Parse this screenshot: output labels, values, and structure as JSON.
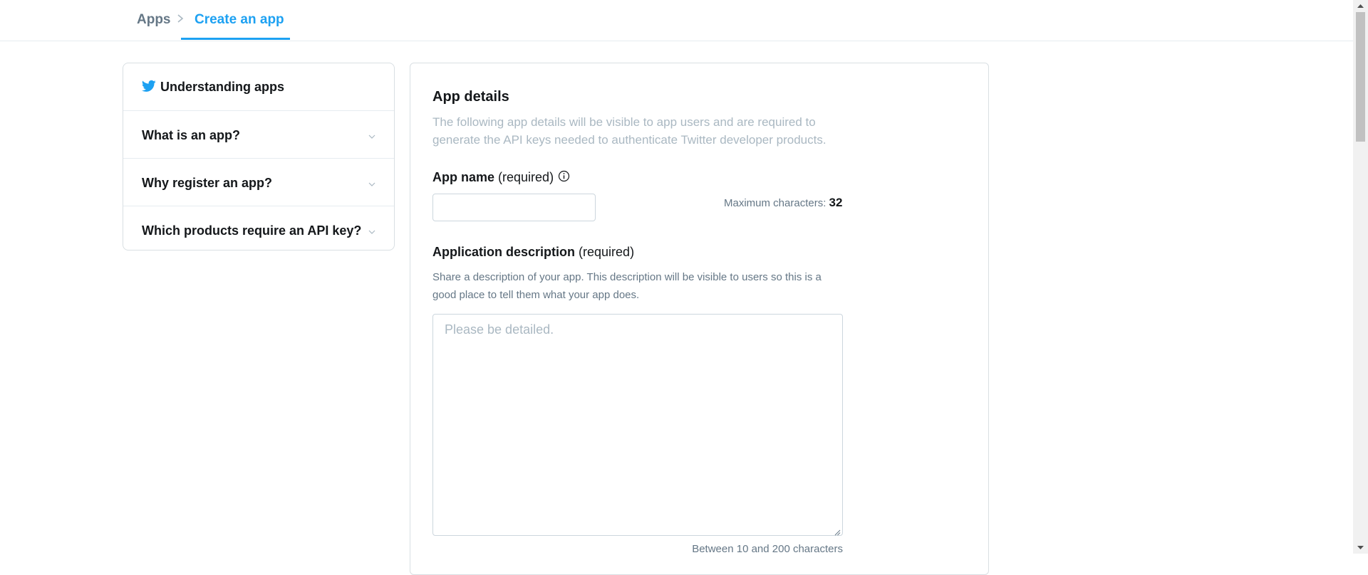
{
  "breadcrumb": {
    "parent_label": "Apps",
    "separator": ">",
    "current_label": "Create an app"
  },
  "sidebar": {
    "title": "Understanding apps",
    "items": [
      {
        "label": "What is an app?"
      },
      {
        "label": "Why register an app?"
      },
      {
        "label": "Which products require an API key?"
      }
    ]
  },
  "form": {
    "section_title": "App details",
    "section_description": "The following app details will be visible to app users and are required to generate the API keys needed to authenticate Twitter developer products.",
    "app_name": {
      "label": "App name",
      "required_text": "(required)",
      "value": "",
      "max_chars_label": "Maximum characters:",
      "max_chars_value": "32"
    },
    "description": {
      "label": "Application description",
      "required_text": "(required)",
      "help_text": "Share a description of your app. This description will be visible to users so this is a good place to tell them what your app does.",
      "placeholder": "Please be detailed.",
      "value": "",
      "char_range": "Between 10 and 200 characters"
    }
  },
  "colors": {
    "accent": "#1da1f2",
    "text_primary": "#14171a",
    "text_secondary": "#657786",
    "text_muted": "#aab8c2",
    "border": "#d9dfe3"
  },
  "icons": {
    "brand": "twitter-bird-icon",
    "info": "info-icon",
    "expand": "chevron-down-icon"
  }
}
